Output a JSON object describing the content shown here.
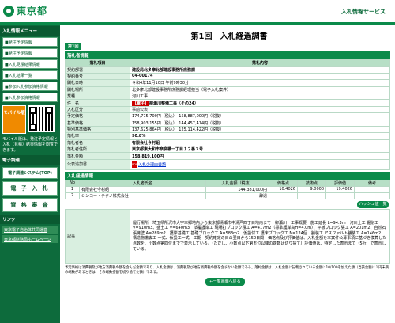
{
  "header": {
    "logo_text": "東京都",
    "right_link": "入札情報サービス"
  },
  "sidebar": {
    "section1": "入札情報メニュー",
    "items": [
      "■発注予定情報",
      "■発注予定情報",
      "■入札見積結果情報",
      "■入札結果一覧",
      "■参加入札参加資格情報",
      "■入札参加資格情報"
    ],
    "mobile_label": "モバイル版",
    "mobile_note": "モバイル版は、発注予定情報と入札（見積）結果情報を閲覧できます。",
    "section2": "電子調達",
    "big_items": [
      "電子調達システム(TOP)",
      "電 子 入 札",
      "資 格 審 査"
    ],
    "section3": "リンク",
    "ext_links": [
      "東京電子自治体共同運営",
      "東京都財務局ホームページ"
    ]
  },
  "main": {
    "title": "第1回　入札経過調書",
    "tab_badge": "第1回",
    "section_info": "落札者情報",
    "info_headers": [
      "落札項目",
      "落札内容"
    ],
    "info_rows": [
      {
        "k": "契約部署",
        "v": "建設局北多摩北部建設事務所庶務課",
        "bold": true
      },
      {
        "k": "契約番号",
        "v": "04-00174",
        "bold": true
      },
      {
        "k": "開札日時",
        "v": "令和4年11月10日 午前9時30分"
      },
      {
        "k": "開札場所",
        "v": "北多摩北部建設事務所庶務課経理担当（電子入札案件）"
      },
      {
        "k": "業種",
        "v": "河川工事"
      },
      {
        "k": "件　名",
        "v_badge": "【電子】",
        "v": "柳瀬川整備工事（その24）",
        "bold": true
      },
      {
        "k": "入札区分",
        "v": "事前公表"
      },
      {
        "k": "予定価格",
        "v": "174,775,700円（税込）　158,887,000円（税抜）"
      },
      {
        "k": "基準価格",
        "v": "158,903,155円（税込）　144,457,414円（税抜）"
      },
      {
        "k": "特別基準価格",
        "v": "137,625,864円（税込）　125,114,422円（税抜）"
      },
      {
        "k": "落札率",
        "v": "90.8%",
        "bold": true
      },
      {
        "k": "落札者名",
        "v": "有限会社今村組",
        "bold": true
      },
      {
        "k": "落札者住所",
        "v": "東京都東大和市奈良橋一丁目１２番３号",
        "bold": true
      },
      {
        "k": "落札金額",
        "v": "158,819,100円",
        "bold": true
      }
    ],
    "public_docs_label": "公表追加書",
    "public_docs_link": "入札の理由書類",
    "section_bids": "入札経過情報",
    "bid_headers": [
      "No",
      "入札者氏名",
      "入札金額（税抜）",
      "価格点",
      "技術点",
      "評価値",
      "備考"
    ],
    "bids": [
      {
        "no": "1",
        "name": "有限会社今村組",
        "amount": "144,381,000円",
        "price": "10.4026",
        "tech": "9.0000",
        "score": "19.4026",
        "note": ""
      },
      {
        "no": "2",
        "name": "シンコー・テクノ株式会社",
        "amount": "辞退",
        "price": "",
        "tech": "",
        "score": "",
        "note": ""
      }
    ],
    "hash_button": "ハッシュ値一覧",
    "notes_label": "記事",
    "notes_text": "履行場所　埼玉県所沢市大字本郷地内から東京都清瀬市中清戸四丁目地内まで　柳瀬川　工事概要　施工延長 L=94.3m　河川土工 掘削工 V=910m3、盛土工 V=640m3　法覆護岸工 現場打ブロック積工 A=417m2（標準護岸高H=4.0m）、平板ブロック張工 A=201m2、自然石張擁壁 A=289m2　護岸基礎工 基礎ブロック工 A=583m2　仮設付工 護床ブロック工 N=124個　舗装工 アスファルト舗装工 A=146m2、構造物撤去工 一式、仮設工一式　工期　契約確定の日の翌日から150日間　価格点及び評価値は、入札金額を本案件公募事項に基づき換算した点数を、小数点第四位までで表示している。（ただし、小数点以下第五位以降の端数は切り捨て）評価値は、特定した表示まで（5桁）で表示している。",
    "footnote": "予定価格は消費税及び地方消費税の額を含んだ金額であり、入札金額は、消費税及び地方消費税の額を含まない金額である。落札金額は、入札金額に記載されている金額に10/100を加えた額（当該金額に１円未満の端数があるときは、その端数金額を切り捨てた額）である。",
    "back_button": "←一覧画面へ戻る"
  }
}
